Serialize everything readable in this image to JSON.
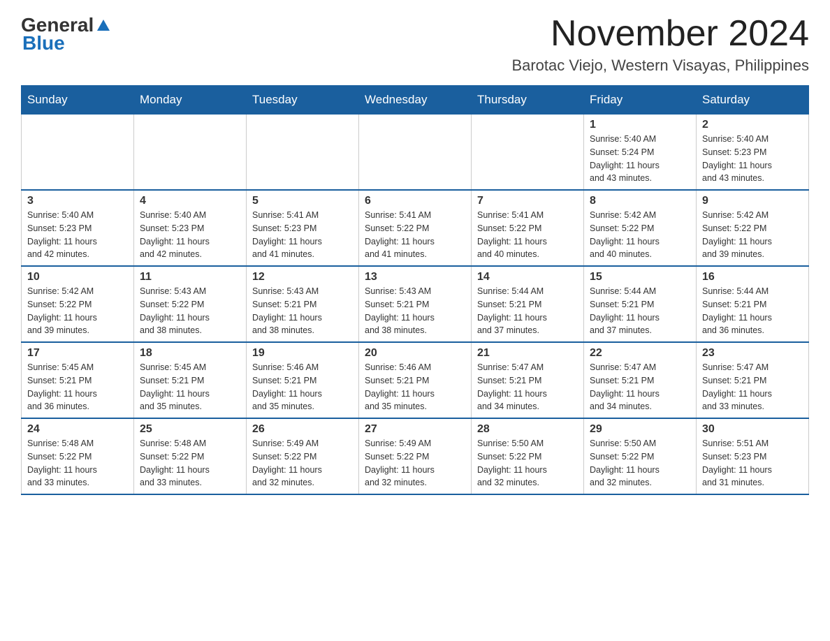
{
  "header": {
    "logo_line1": "General",
    "logo_triangle_color": "#1a6fba",
    "logo_line2": "Blue",
    "main_title": "November 2024",
    "subtitle": "Barotac Viejo, Western Visayas, Philippines"
  },
  "calendar": {
    "days_of_week": [
      "Sunday",
      "Monday",
      "Tuesday",
      "Wednesday",
      "Thursday",
      "Friday",
      "Saturday"
    ],
    "weeks": [
      [
        {
          "day": "",
          "info": ""
        },
        {
          "day": "",
          "info": ""
        },
        {
          "day": "",
          "info": ""
        },
        {
          "day": "",
          "info": ""
        },
        {
          "day": "",
          "info": ""
        },
        {
          "day": "1",
          "info": "Sunrise: 5:40 AM\nSunset: 5:24 PM\nDaylight: 11 hours\nand 43 minutes."
        },
        {
          "day": "2",
          "info": "Sunrise: 5:40 AM\nSunset: 5:23 PM\nDaylight: 11 hours\nand 43 minutes."
        }
      ],
      [
        {
          "day": "3",
          "info": "Sunrise: 5:40 AM\nSunset: 5:23 PM\nDaylight: 11 hours\nand 42 minutes."
        },
        {
          "day": "4",
          "info": "Sunrise: 5:40 AM\nSunset: 5:23 PM\nDaylight: 11 hours\nand 42 minutes."
        },
        {
          "day": "5",
          "info": "Sunrise: 5:41 AM\nSunset: 5:23 PM\nDaylight: 11 hours\nand 41 minutes."
        },
        {
          "day": "6",
          "info": "Sunrise: 5:41 AM\nSunset: 5:22 PM\nDaylight: 11 hours\nand 41 minutes."
        },
        {
          "day": "7",
          "info": "Sunrise: 5:41 AM\nSunset: 5:22 PM\nDaylight: 11 hours\nand 40 minutes."
        },
        {
          "day": "8",
          "info": "Sunrise: 5:42 AM\nSunset: 5:22 PM\nDaylight: 11 hours\nand 40 minutes."
        },
        {
          "day": "9",
          "info": "Sunrise: 5:42 AM\nSunset: 5:22 PM\nDaylight: 11 hours\nand 39 minutes."
        }
      ],
      [
        {
          "day": "10",
          "info": "Sunrise: 5:42 AM\nSunset: 5:22 PM\nDaylight: 11 hours\nand 39 minutes."
        },
        {
          "day": "11",
          "info": "Sunrise: 5:43 AM\nSunset: 5:22 PM\nDaylight: 11 hours\nand 38 minutes."
        },
        {
          "day": "12",
          "info": "Sunrise: 5:43 AM\nSunset: 5:21 PM\nDaylight: 11 hours\nand 38 minutes."
        },
        {
          "day": "13",
          "info": "Sunrise: 5:43 AM\nSunset: 5:21 PM\nDaylight: 11 hours\nand 38 minutes."
        },
        {
          "day": "14",
          "info": "Sunrise: 5:44 AM\nSunset: 5:21 PM\nDaylight: 11 hours\nand 37 minutes."
        },
        {
          "day": "15",
          "info": "Sunrise: 5:44 AM\nSunset: 5:21 PM\nDaylight: 11 hours\nand 37 minutes."
        },
        {
          "day": "16",
          "info": "Sunrise: 5:44 AM\nSunset: 5:21 PM\nDaylight: 11 hours\nand 36 minutes."
        }
      ],
      [
        {
          "day": "17",
          "info": "Sunrise: 5:45 AM\nSunset: 5:21 PM\nDaylight: 11 hours\nand 36 minutes."
        },
        {
          "day": "18",
          "info": "Sunrise: 5:45 AM\nSunset: 5:21 PM\nDaylight: 11 hours\nand 35 minutes."
        },
        {
          "day": "19",
          "info": "Sunrise: 5:46 AM\nSunset: 5:21 PM\nDaylight: 11 hours\nand 35 minutes."
        },
        {
          "day": "20",
          "info": "Sunrise: 5:46 AM\nSunset: 5:21 PM\nDaylight: 11 hours\nand 35 minutes."
        },
        {
          "day": "21",
          "info": "Sunrise: 5:47 AM\nSunset: 5:21 PM\nDaylight: 11 hours\nand 34 minutes."
        },
        {
          "day": "22",
          "info": "Sunrise: 5:47 AM\nSunset: 5:21 PM\nDaylight: 11 hours\nand 34 minutes."
        },
        {
          "day": "23",
          "info": "Sunrise: 5:47 AM\nSunset: 5:21 PM\nDaylight: 11 hours\nand 33 minutes."
        }
      ],
      [
        {
          "day": "24",
          "info": "Sunrise: 5:48 AM\nSunset: 5:22 PM\nDaylight: 11 hours\nand 33 minutes."
        },
        {
          "day": "25",
          "info": "Sunrise: 5:48 AM\nSunset: 5:22 PM\nDaylight: 11 hours\nand 33 minutes."
        },
        {
          "day": "26",
          "info": "Sunrise: 5:49 AM\nSunset: 5:22 PM\nDaylight: 11 hours\nand 32 minutes."
        },
        {
          "day": "27",
          "info": "Sunrise: 5:49 AM\nSunset: 5:22 PM\nDaylight: 11 hours\nand 32 minutes."
        },
        {
          "day": "28",
          "info": "Sunrise: 5:50 AM\nSunset: 5:22 PM\nDaylight: 11 hours\nand 32 minutes."
        },
        {
          "day": "29",
          "info": "Sunrise: 5:50 AM\nSunset: 5:22 PM\nDaylight: 11 hours\nand 32 minutes."
        },
        {
          "day": "30",
          "info": "Sunrise: 5:51 AM\nSunset: 5:23 PM\nDaylight: 11 hours\nand 31 minutes."
        }
      ]
    ]
  }
}
